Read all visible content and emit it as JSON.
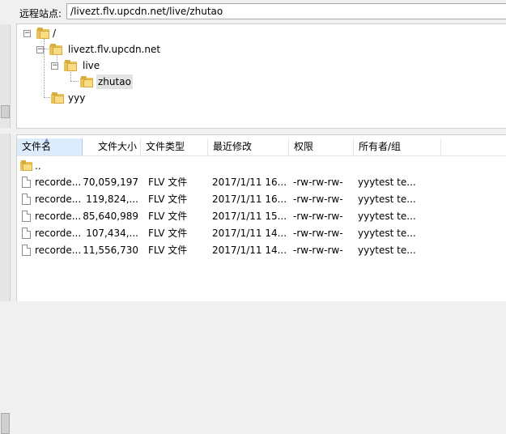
{
  "remote_site": {
    "label": "远程站点:",
    "path": "/livezt.flv.upcdn.net/live/zhutao"
  },
  "tree": {
    "root": "/",
    "host": "livezt.flv.upcdn.net",
    "live": "live",
    "zhutao": "zhutao",
    "yyy": "yyy",
    "expander_minus": "−"
  },
  "columns": {
    "name": "文件名",
    "size": "文件大小",
    "type": "文件类型",
    "modified": "最近修改",
    "perms": "权限",
    "owner": "所有者/组"
  },
  "parent_dir": "..",
  "files": [
    {
      "name": "recorde...",
      "size": "70,059,197",
      "type": "FLV 文件",
      "modified": "2017/1/11 16...",
      "perms": "-rw-rw-rw-",
      "owner": "yyytest te..."
    },
    {
      "name": "recorde...",
      "size": "119,824,...",
      "type": "FLV 文件",
      "modified": "2017/1/11 16...",
      "perms": "-rw-rw-rw-",
      "owner": "yyytest te..."
    },
    {
      "name": "recorde...",
      "size": "85,640,989",
      "type": "FLV 文件",
      "modified": "2017/1/11 15...",
      "perms": "-rw-rw-rw-",
      "owner": "yyytest te..."
    },
    {
      "name": "recorde...",
      "size": "107,434,...",
      "type": "FLV 文件",
      "modified": "2017/1/11 14...",
      "perms": "-rw-rw-rw-",
      "owner": "yyytest te..."
    },
    {
      "name": "recorde...",
      "size": "11,556,730",
      "type": "FLV 文件",
      "modified": "2017/1/11 14...",
      "perms": "-rw-rw-rw-",
      "owner": "yyytest te..."
    }
  ],
  "colors": {
    "folder": "#e8c35c",
    "header_active": "#dcecfc",
    "selected_node": "#e3e3e3"
  }
}
